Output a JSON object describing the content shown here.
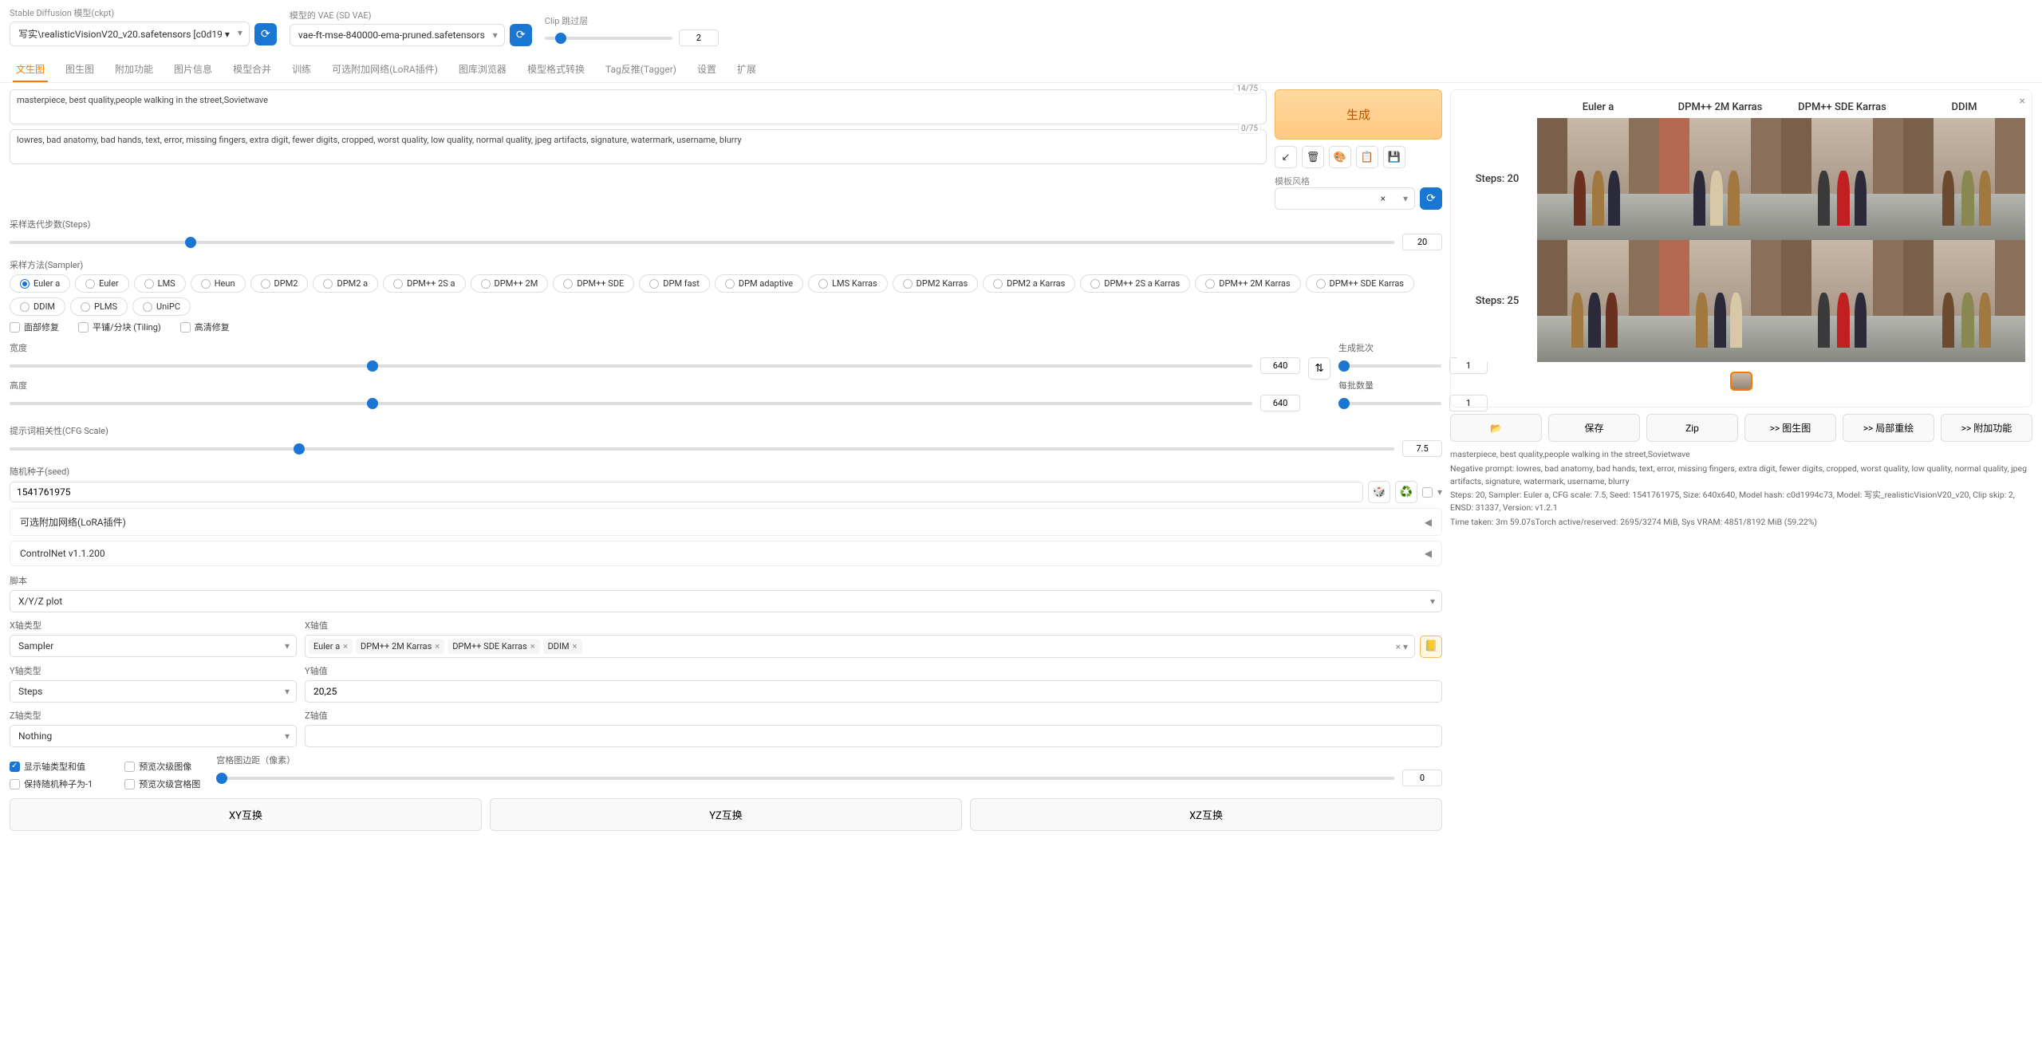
{
  "top": {
    "ckpt_label": "Stable Diffusion 模型(ckpt)",
    "ckpt_value": "写实\\realisticVisionV20_v20.safetensors [c0d19 ▾",
    "vae_label": "模型的 VAE (SD VAE)",
    "vae_value": "vae-ft-mse-840000-ema-pruned.safetensors",
    "clip_label": "Clip 跳过层",
    "clip_value": "2"
  },
  "tabs": [
    "文生图",
    "图生图",
    "附加功能",
    "图片信息",
    "模型合并",
    "训练",
    "可选附加网络(LoRA插件)",
    "图库浏览器",
    "模型格式转换",
    "Tag反推(Tagger)",
    "设置",
    "扩展"
  ],
  "active_tab": 0,
  "prompt": {
    "positive": "masterpiece, best quality,people walking in the street,Sovietwave",
    "positive_count": "14/75",
    "negative": "lowres, bad anatomy, bad hands, text, error, missing fingers, extra digit, fewer digits, cropped, worst quality, low quality, normal quality, jpeg artifacts, signature, watermark, username, blurry",
    "negative_count": "0/75"
  },
  "generate_label": "生成",
  "style_label": "模板风格",
  "style_clear": "×",
  "steps": {
    "label": "采样迭代步数(Steps)",
    "value": "20"
  },
  "sampler": {
    "label": "采样方法(Sampler)",
    "options": [
      "Euler a",
      "Euler",
      "LMS",
      "Heun",
      "DPM2",
      "DPM2 a",
      "DPM++ 2S a",
      "DPM++ 2M",
      "DPM++ SDE",
      "DPM fast",
      "DPM adaptive",
      "LMS Karras",
      "DPM2 Karras",
      "DPM2 a Karras",
      "DPM++ 2S a Karras",
      "DPM++ 2M Karras",
      "DPM++ SDE Karras",
      "DDIM",
      "PLMS",
      "UniPC"
    ],
    "selected": "Euler a"
  },
  "checks": {
    "face": "面部修复",
    "tiling": "平铺/分块 (Tiling)",
    "hires": "高清修复"
  },
  "dims": {
    "width_label": "宽度",
    "width": "640",
    "height_label": "高度",
    "height": "640",
    "batch_count_label": "生成批次",
    "batch_count": "1",
    "batch_size_label": "每批数量",
    "batch_size": "1"
  },
  "cfg": {
    "label": "提示词相关性(CFG Scale)",
    "value": "7.5"
  },
  "seed": {
    "label": "随机种子(seed)",
    "value": "1541761975"
  },
  "accordions": {
    "lora": "可选附加网络(LoRA插件)",
    "controlnet": "ControlNet v1.1.200"
  },
  "script": {
    "label": "脚本",
    "value": "X/Y/Z plot"
  },
  "xyz": {
    "x_type_label": "X轴类型",
    "x_type": "Sampler",
    "x_val_label": "X轴值",
    "x_tags": [
      "Euler a",
      "DPM++ 2M Karras",
      "DPM++ SDE Karras",
      "DDIM"
    ],
    "y_type_label": "Y轴类型",
    "y_type": "Steps",
    "y_val_label": "Y轴值",
    "y_val": "20,25",
    "z_type_label": "Z轴类型",
    "z_type": "Nothing",
    "z_val_label": "Z轴值",
    "z_val": ""
  },
  "xyz_checks": {
    "show_axes": "显示轴类型和值",
    "include_sub": "预览次级图像",
    "keep_seed": "保持随机种子为-1",
    "include_grid": "预览次级宫格图",
    "margin_label": "宫格图边距（像素）",
    "margin_val": "0"
  },
  "swap_btns": [
    "XY互换",
    "YZ互换",
    "XZ互换"
  ],
  "output": {
    "col_headers": [
      "Euler a",
      "DPM++ 2M Karras",
      "DPM++ SDE Karras",
      "DDIM"
    ],
    "row_labels": [
      "Steps: 20",
      "Steps: 25"
    ],
    "actions": {
      "save": "保存",
      "zip": "Zip",
      "img2img": ">> 图生图",
      "inpaint": ">> 局部重绘",
      "extras": ">> 附加功能"
    },
    "info_pos": "masterpiece, best quality,people walking in the street,Sovietwave",
    "info_neg": "Negative prompt: lowres, bad anatomy, bad hands, text, error, missing fingers, extra digit, fewer digits, cropped, worst quality, low quality, normal quality, jpeg artifacts, signature, watermark, username, blurry",
    "info_params": "Steps: 20, Sampler: Euler a, CFG scale: 7.5, Seed: 1541761975, Size: 640x640, Model hash: c0d1994c73, Model: 写实_realisticVisionV20_v20, Clip skip: 2, ENSD: 31337, Version: v1.2.1",
    "info_time": "Time taken: 3m 59.07sTorch active/reserved: 2695/3274 MiB, Sys VRAM: 4851/8192 MiB (59.22%)"
  },
  "chart_data": {
    "type": "table",
    "title": "X/Y/Z plot sampler × steps grid",
    "columns": [
      "Euler a",
      "DPM++ 2M Karras",
      "DPM++ SDE Karras",
      "DDIM"
    ],
    "rows": [
      "Steps: 20",
      "Steps: 25"
    ],
    "cells": "8 generated images (4 samplers × 2 step-counts) of people walking in a Soviet-style street"
  }
}
